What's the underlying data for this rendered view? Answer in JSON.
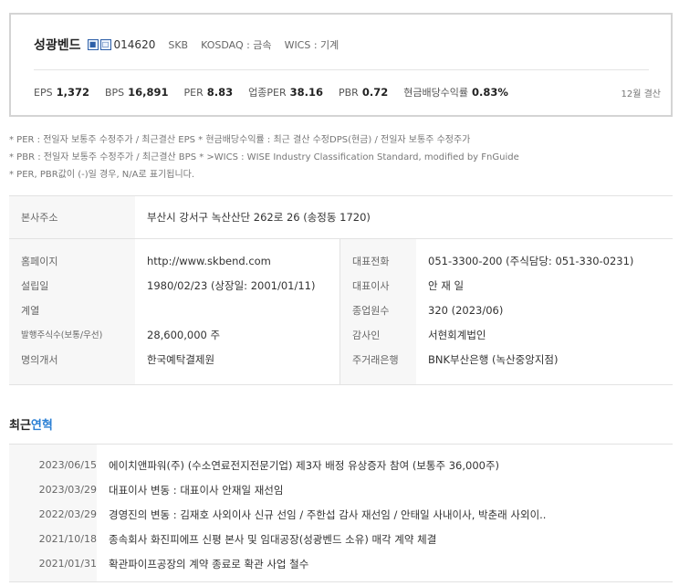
{
  "company": {
    "name": "성광벤드",
    "code": "014620",
    "sub_name": "SKB",
    "market": "KOSDAQ : 금속",
    "wics": "WICS : 기계",
    "icons": [
      "building-icon",
      "document-icon"
    ]
  },
  "metrics": [
    {
      "label": "EPS",
      "value": "1,372"
    },
    {
      "label": "BPS",
      "value": "16,891"
    },
    {
      "label": "PER",
      "value": "8.83"
    },
    {
      "label": "업종PER",
      "value": "38.16"
    },
    {
      "label": "PBR",
      "value": "0.72"
    },
    {
      "label": "현금배당수익률",
      "value": "0.83%"
    }
  ],
  "settlement": "12월 결산",
  "notes": [
    "* PER : 전일자 보통주 수정주가 / 최근결산 EPS * 현금배당수익률 : 최근 결산 수정DPS(현금) / 전일자 보통주 수정주가",
    "* PBR : 전일자 보통주 수정주가 / 최근결산 BPS * >WICS : WISE Industry Classification Standard, modified by FnGuide",
    "* PER, PBR값이 (-)일 경우, N/A로 표기됩니다."
  ],
  "info": {
    "address_label": "본사주소",
    "address": "부산시 강서구 녹산산단 262로 26 (송정동 1720)",
    "left_labels": [
      "홈페이지",
      "설립일",
      "계열",
      "발행주식수(보통/우선)",
      "명의개서"
    ],
    "left_values": [
      "http://www.skbend.com",
      "1980/02/23 (상장일: 2001/01/11)",
      "",
      "28,600,000 주",
      "한국예탁결제원"
    ],
    "right_labels": [
      "대표전화",
      "대표이사",
      "종업원수",
      "감사인",
      "주거래은행"
    ],
    "right_values": [
      "051-3300-200 (주식담당: 051-330-0231)",
      "안 재 일",
      "320 (2023/06)",
      "서현회계법인",
      "BNK부산은행 (녹산중앙지점)"
    ]
  },
  "history": {
    "title_prefix": "최근",
    "title_accent": "연혁",
    "items": [
      {
        "date": "2023/06/15",
        "text": "에이치앤파워(주) (수소연료전지전문기업) 제3자 배정 유상증자 참여 (보통주 36,000주)"
      },
      {
        "date": "2023/03/29",
        "text": "대표이사 변동 : 대표이사 안재일 재선임"
      },
      {
        "date": "2022/03/29",
        "text": "경영진의 변동 : 김재호 사외이사 신규 선임 / 주한섭 감사 재선임 / 안태일 사내이사, 박춘래 사외이.."
      },
      {
        "date": "2021/10/18",
        "text": "종속회사 화진피에프 신평 본사 및 임대공장(성광벤드 소유) 매각 계약 체결"
      },
      {
        "date": "2021/01/31",
        "text": "확관파이프공장의 계약 종료로 확관 사업 철수"
      }
    ]
  },
  "colors": {
    "accent": "#2a7fd4",
    "border": "#d4d4d4",
    "label_bg": "#f7f7f7"
  }
}
